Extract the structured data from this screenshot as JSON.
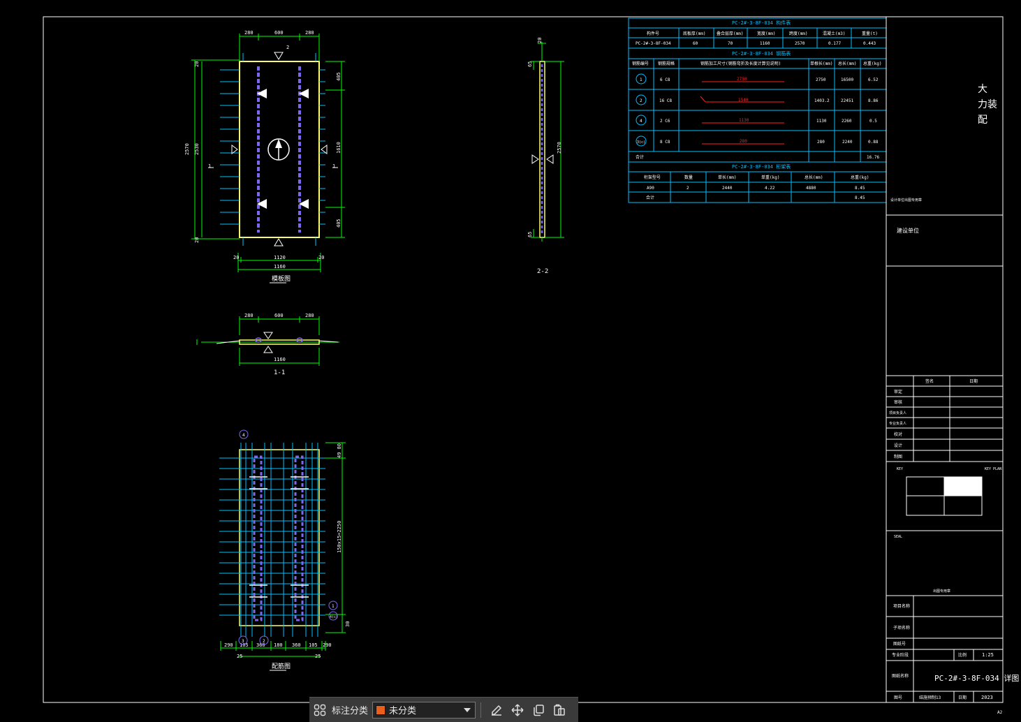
{
  "colors": {
    "frame": "#ffffff",
    "dim": "#00ff00",
    "table": "#00bfff",
    "rebar": "#7b68ee",
    "red": "#ff2020",
    "panel": "#ffff66",
    "accent": "#e8601c"
  },
  "views": {
    "elevation": {
      "caption": "模板图",
      "dims_top": [
        "280",
        "600",
        "280"
      ],
      "dims_bottom1": [
        "20",
        "1120",
        "20"
      ],
      "dims_bottom2": "1160",
      "dims_left_outer": "2570",
      "dims_left_inner": "2530",
      "dims_left_top": "20",
      "dims_left_bottom": "20",
      "dims_right": [
        "405",
        "1610",
        "405"
      ],
      "marker_top": "2",
      "marker_left": "1",
      "marker_right": "1"
    },
    "section11": {
      "caption": "1-1",
      "dims_top": [
        "280",
        "600",
        "280"
      ],
      "dims_bottom": "1160"
    },
    "section22": {
      "caption": "2-2",
      "dim_top": "20",
      "dim_a": "65",
      "dim_mid": "2570",
      "dim_b": "65"
    },
    "rebar": {
      "caption": "配筋图",
      "dims_bottom1": [
        "290",
        "105",
        "360",
        "180",
        "360",
        "105",
        "290"
      ],
      "dims_bottom2": [
        "25",
        "25"
      ],
      "dim_right_top": "49 80",
      "dim_right_mid": "150x15=2250",
      "dim_right_bottom": "30",
      "tags": [
        "4",
        "1",
        "3",
        "2",
        "4(c)"
      ]
    }
  },
  "table1": {
    "title": "PC-2#-3-8F-034 构件表",
    "headers": [
      "构件号",
      "底板厚(mm)",
      "叠合层厚(mm)",
      "宽度(mm)",
      "跨度(mm)",
      "混凝土(m3)",
      "重量(t)"
    ],
    "row": [
      "PC-2#-3-8F-034",
      "60",
      "70",
      "1160",
      "2570",
      "0.177",
      "0.443"
    ]
  },
  "table2": {
    "title": "PC-2#-3-8F-034 钢筋表",
    "headers": [
      "钢筋编号",
      "钢筋规格",
      "钢筋加工尺寸(钢筋弯折及长度计算见说明)",
      "单根长(mm)",
      "总长(mm)",
      "总重(kg)"
    ],
    "rows": [
      {
        "no": "1",
        "spec": "6 C8",
        "shape": "2750",
        "len": "2750",
        "total": "16500",
        "wt": "6.52"
      },
      {
        "no": "2",
        "spec": "16 C8",
        "shape": "1540",
        "len": "1403.2",
        "total": "22451",
        "wt": "8.86"
      },
      {
        "no": "4",
        "spec": "2 C6",
        "shape": "1130",
        "len": "1130",
        "total": "2260",
        "wt": "0.5"
      },
      {
        "no": "3(c)",
        "spec": "8 C8",
        "shape": "280",
        "len": "280",
        "total": "2240",
        "wt": "0.88"
      }
    ],
    "sum_label": "合计",
    "sum": "16.76"
  },
  "table3": {
    "title": "PC-2#-3-8F-034 桁架表",
    "headers": [
      "桁架型号",
      "数量",
      "单长(mm)",
      "单重(kg)",
      "总长(mm)",
      "总重(kg)"
    ],
    "row": [
      "A90",
      "2",
      "2440",
      "4.22",
      "4880",
      "8.45"
    ],
    "sum_label": "合计",
    "sum": "8.45"
  },
  "titleblock": {
    "stamp": [
      "大",
      "力装",
      "配"
    ],
    "company_note": "设计单位出图专用章",
    "design_unit": "建设单位",
    "sign_headers": [
      "签名",
      "日期"
    ],
    "roles": [
      "审定",
      "审核",
      "项目负责人",
      "专业负责人",
      "校对",
      "设计",
      "制图"
    ],
    "keyplan_left": "KEY",
    "keyplan_right": "KEY PLAN",
    "seal_label": "SEAL",
    "seal_note": "出图专用章",
    "project_label": "项目名称",
    "subproject_label": "子项名称",
    "drawing_no_label": "图纸号",
    "stage_label": "专业阶段",
    "scale_label": "比例",
    "scale": "1:25",
    "drawing_name_label": "图纸名称",
    "drawing_name": "PC-2#-3-8F-034 详图",
    "no_label": "图号",
    "no_value": "结施预制13",
    "date_label": "日期",
    "date": "2023",
    "sheet_size": "A2"
  },
  "toolbar": {
    "label": "标注分类",
    "category": "未分类"
  }
}
